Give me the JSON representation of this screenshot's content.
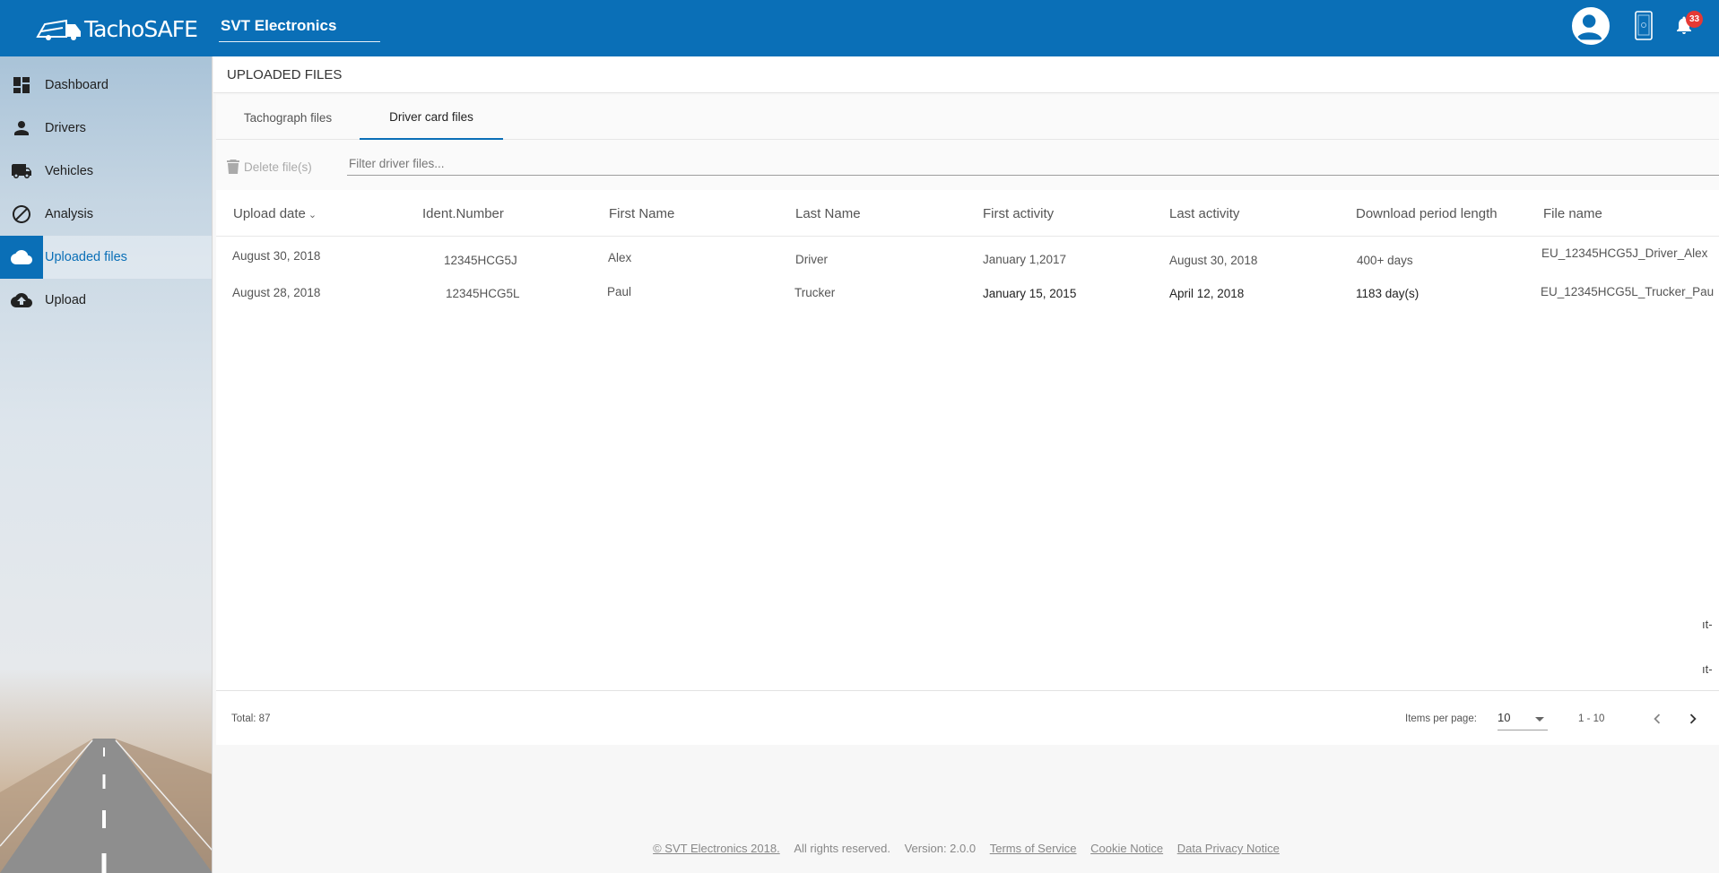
{
  "app": {
    "logo_text": "TachoSAFE",
    "company": "SVT Electronics",
    "notification_count": "33"
  },
  "icons": {
    "logo": "truck-logo-icon",
    "account": "account-circle-icon",
    "device": "tablet-icon",
    "notifications": "bell-icon"
  },
  "colors": {
    "primary": "#0a6fb7",
    "badge": "#e53935"
  },
  "sidebar": {
    "items": [
      {
        "label": "Dashboard",
        "icon": "dashboard-icon"
      },
      {
        "label": "Drivers",
        "icon": "person-icon"
      },
      {
        "label": "Vehicles",
        "icon": "truck-icon"
      },
      {
        "label": "Analysis",
        "icon": "block-icon"
      },
      {
        "label": "Uploaded files",
        "icon": "cloud-icon",
        "active": true
      },
      {
        "label": "Upload",
        "icon": "cloud-upload-icon"
      }
    ]
  },
  "page": {
    "title": "UPLOADED FILES",
    "tabs": [
      "Tachograph files",
      "Driver card files"
    ],
    "active_tab": "Driver card files"
  },
  "toolbar": {
    "delete_label": "Delete file(s)",
    "filter_placeholder": "Filter driver files..."
  },
  "table": {
    "headers": [
      "Upload date",
      "Ident.Number",
      "First Name",
      "Last Name",
      "First activity",
      "Last activity",
      "Download period length",
      "File name"
    ],
    "sorted_by": "Upload date",
    "rows": [
      [
        "August 30, 2018",
        "12345HCG5J",
        "Alex",
        "Driver",
        "January 1,2017",
        "August 30, 2018",
        "400+ days",
        "EU_12345HCG5J_Driver_Alex"
      ],
      [
        "August 28, 2018",
        "12345HCG5L",
        "Paul",
        "Trucker",
        "January 15, 2015",
        "April 12, 2018",
        "1183 day(s)",
        "EU_12345HCG5L_Trucker_Pau"
      ]
    ],
    "overflow_fragments": [
      "ıt-",
      "ıt-"
    ]
  },
  "paginator": {
    "total": "Total: 87",
    "items_per_page_label": "Items per page:",
    "items_per_page": "10",
    "range": "1 - 10"
  },
  "footer": {
    "copyright": "© SVT Electronics 2018.",
    "rights": "All rights reserved.",
    "version": "Version: 2.0.0",
    "terms": "Terms of Service",
    "cookie": "Cookie Notice",
    "privacy": "Data Privacy Notice"
  }
}
